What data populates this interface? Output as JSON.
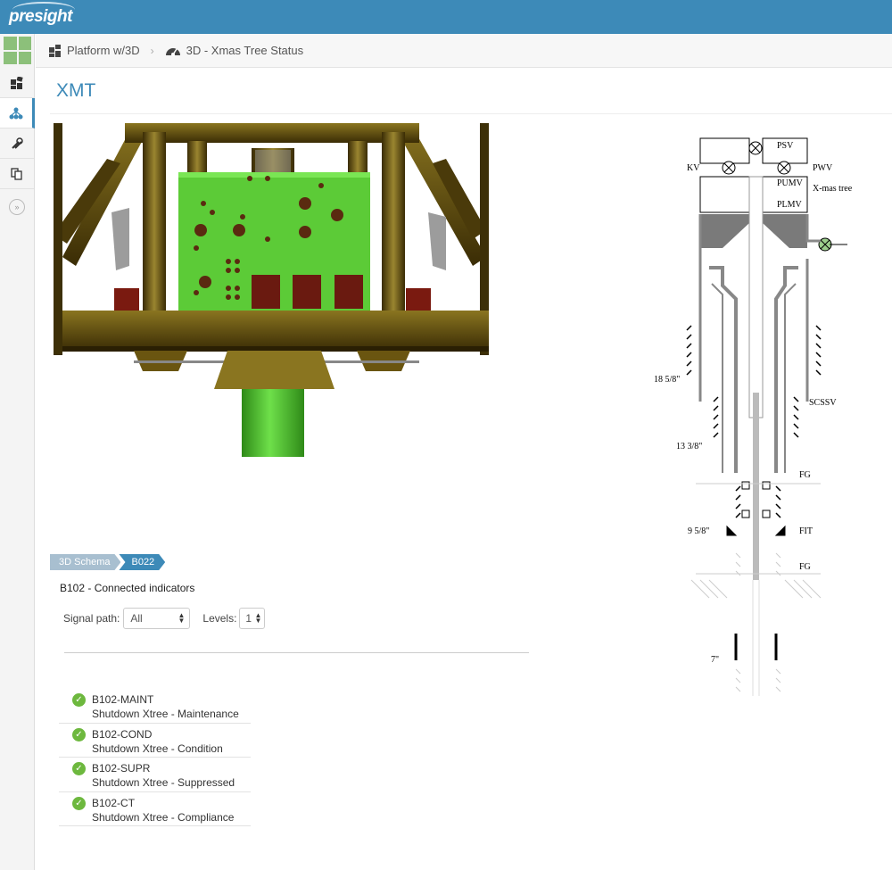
{
  "app": {
    "logo": "presight"
  },
  "sidebar": {
    "items": [
      {
        "icon": "dashboard-icon",
        "active": false
      },
      {
        "icon": "hierarchy-icon",
        "active": true
      },
      {
        "icon": "tools-icon",
        "active": false
      },
      {
        "icon": "documents-icon",
        "active": false
      }
    ],
    "expand_label": "»"
  },
  "breadcrumb": [
    {
      "icon": "platform-icon",
      "label": "Platform w/3D"
    },
    {
      "icon": "gauge-icon",
      "label": "3D - Xmas Tree Status"
    }
  ],
  "page": {
    "title": "XMT"
  },
  "schematic": {
    "labels": {
      "psv": "PSV",
      "kv": "KV",
      "pwv": "PWV",
      "pumv": "PUMV",
      "plmv": "PLMV",
      "xmas_tree": "X-mas tree",
      "scssv": "SCSSV",
      "fg1": "FG",
      "fit": "FIT",
      "fg2": "FG",
      "c18": "18 5/8\"",
      "c13": "13 3/8\"",
      "c9": "9 5/8\"",
      "c7": "7\""
    }
  },
  "tabs": [
    "3D Schema",
    "B022"
  ],
  "section": {
    "heading": "B102 - Connected indicators"
  },
  "controls": {
    "signal_path_label": "Signal path:",
    "signal_path_value": "All",
    "levels_label": "Levels:",
    "levels_value": "1"
  },
  "indicators": [
    {
      "code": "B102-MAINT",
      "description": "Shutdown Xtree - Maintenance"
    },
    {
      "code": "B102-COND",
      "description": "Shutdown Xtree - Condition"
    },
    {
      "code": "B102-SUPR",
      "description": "Shutdown Xtree - Suppressed"
    },
    {
      "code": "B102-CT",
      "description": "Shutdown Xtree - Compliance"
    }
  ],
  "colors": {
    "accent": "#3d8ab8",
    "status_ok": "#6db83e",
    "model_green": "#5ccb37",
    "model_frame": "#4a3a0a"
  }
}
